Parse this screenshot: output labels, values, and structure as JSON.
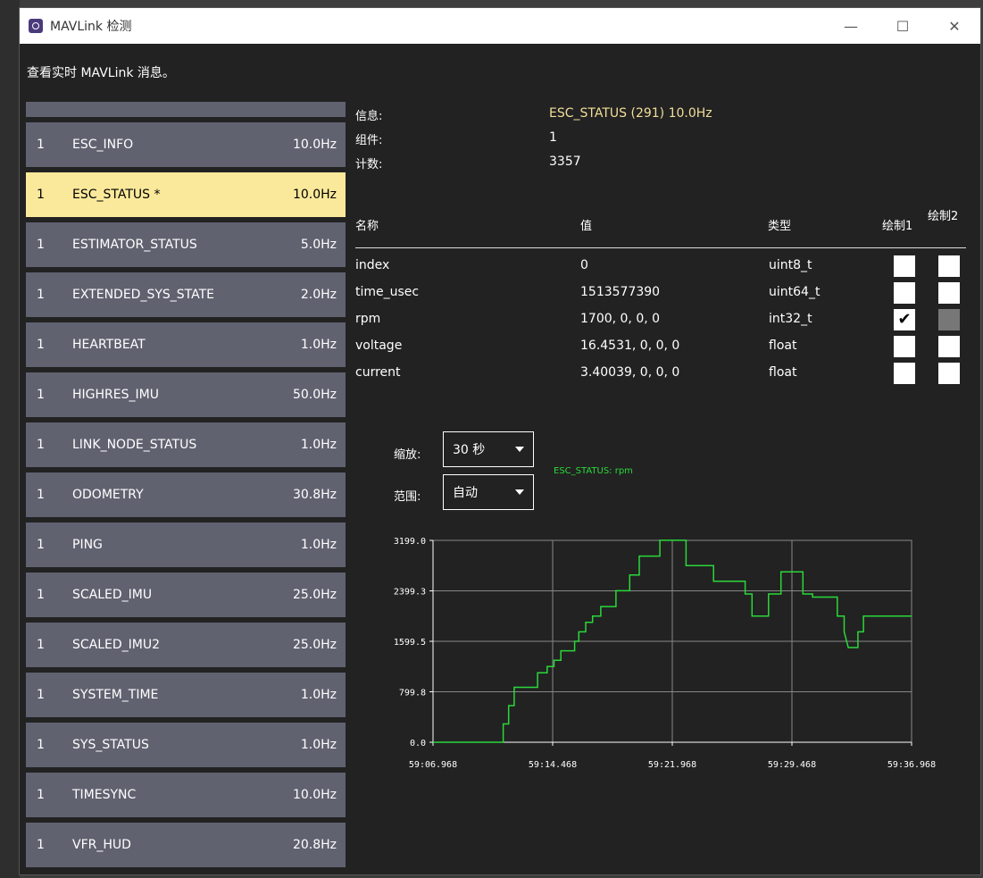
{
  "window": {
    "title": "MAVLink 检测",
    "minimize_icon": "—",
    "maximize_icon": "☐",
    "close_icon": "✕"
  },
  "description": "查看实时 MAVLink 消息。",
  "messages": [
    {
      "comp": "1",
      "name": "ESC_INFO",
      "hz": "10.0Hz"
    },
    {
      "comp": "1",
      "name": "ESC_STATUS *",
      "hz": "10.0Hz",
      "selected": true
    },
    {
      "comp": "1",
      "name": "ESTIMATOR_STATUS",
      "hz": "5.0Hz"
    },
    {
      "comp": "1",
      "name": "EXTENDED_SYS_STATE",
      "hz": "2.0Hz"
    },
    {
      "comp": "1",
      "name": "HEARTBEAT",
      "hz": "1.0Hz"
    },
    {
      "comp": "1",
      "name": "HIGHRES_IMU",
      "hz": "50.0Hz"
    },
    {
      "comp": "1",
      "name": "LINK_NODE_STATUS",
      "hz": "1.0Hz"
    },
    {
      "comp": "1",
      "name": "ODOMETRY",
      "hz": "30.8Hz"
    },
    {
      "comp": "1",
      "name": "PING",
      "hz": "1.0Hz"
    },
    {
      "comp": "1",
      "name": "SCALED_IMU",
      "hz": "25.0Hz"
    },
    {
      "comp": "1",
      "name": "SCALED_IMU2",
      "hz": "25.0Hz"
    },
    {
      "comp": "1",
      "name": "SYSTEM_TIME",
      "hz": "1.0Hz"
    },
    {
      "comp": "1",
      "name": "SYS_STATUS",
      "hz": "1.0Hz"
    },
    {
      "comp": "1",
      "name": "TIMESYNC",
      "hz": "10.0Hz"
    },
    {
      "comp": "1",
      "name": "VFR_HUD",
      "hz": "20.8Hz"
    }
  ],
  "info": {
    "message_label": "信息:",
    "message_value": "ESC_STATUS (291) 10.0Hz",
    "component_label": "组件:",
    "component_value": "1",
    "count_label": "计数:",
    "count_value": "3357"
  },
  "fields_table": {
    "headers": {
      "name": "名称",
      "value": "值",
      "type": "类型",
      "plot1": "绘制1",
      "plot2": "绘制2"
    },
    "rows": [
      {
        "name": "index",
        "value": "0",
        "type": "uint8_t",
        "plot1": false,
        "plot2": false
      },
      {
        "name": "time_usec",
        "value": "1513577390",
        "type": "uint64_t",
        "plot1": false,
        "plot2": false
      },
      {
        "name": "rpm",
        "value": "1700, 0, 0, 0",
        "type": "int32_t",
        "plot1": true,
        "plot2": false,
        "plot2_disabled": true
      },
      {
        "name": "voltage",
        "value": "16.4531, 0, 0, 0",
        "type": "float",
        "plot1": false,
        "plot2": false
      },
      {
        "name": "current",
        "value": "3.40039, 0, 0, 0",
        "type": "float",
        "plot1": false,
        "plot2": false
      }
    ],
    "check_glyph": "✔"
  },
  "controls": {
    "zoom_label": "缩放:",
    "zoom_value": "30 秒",
    "range_label": "范围:",
    "range_value": "自动"
  },
  "chart_data": {
    "type": "line",
    "series": [
      {
        "name": "ESC_STATUS: rpm",
        "color": "#2ad83a",
        "x": [
          0,
          5.1,
          5.1,
          5.5,
          5.5,
          5.9,
          5.9,
          6.2,
          6.2,
          7.6,
          7.6,
          8.3,
          8.3,
          8.8,
          8.8,
          9.3,
          9.3,
          10.3,
          10.3,
          10.6,
          10.6,
          11.1,
          11.1,
          11.6,
          11.6,
          12.2,
          12.2,
          13.3,
          13.3,
          14.3,
          14.3,
          15,
          15,
          16.5,
          16.5,
          17.3,
          17.3,
          17.7,
          17.7,
          18.4,
          18.4,
          20.4,
          20.4,
          21.1,
          21.1,
          22.7,
          22.7,
          23.2,
          23.2,
          24.4,
          24.4,
          25.3,
          25.3,
          26.9,
          26.9,
          27.6,
          27.6,
          29.4,
          29.4,
          29.9,
          29.9,
          30.2,
          30.5,
          30.9,
          30.9,
          31.3,
          31.3,
          34.8
        ],
        "y": [
          0,
          0,
          290,
          290,
          580,
          580,
          870,
          870,
          870,
          870,
          1100,
          1100,
          1200,
          1200,
          1300,
          1300,
          1450,
          1450,
          1600,
          1600,
          1750,
          1750,
          1900,
          1900,
          2000,
          2000,
          2150,
          2150,
          2400,
          2400,
          2650,
          2650,
          2950,
          2950,
          3200,
          3200,
          3200,
          3200,
          3200,
          3200,
          2800,
          2800,
          2550,
          2550,
          2550,
          2550,
          2350,
          2350,
          2000,
          2000,
          2350,
          2350,
          2700,
          2700,
          2350,
          2350,
          2300,
          2300,
          2000,
          2000,
          1750,
          1500,
          1500,
          1500,
          1750,
          1750,
          2000,
          2000
        ]
      }
    ],
    "xticks": [
      "59:06.968",
      "59:14.468",
      "59:21.968",
      "59:29.468",
      "59:36.968"
    ],
    "yticks": [
      "0.0",
      "799.8",
      "1599.5",
      "2399.3",
      "3199.0"
    ],
    "xlim": [
      0,
      34.8
    ],
    "ylim": [
      0,
      3199
    ],
    "grid": true
  }
}
